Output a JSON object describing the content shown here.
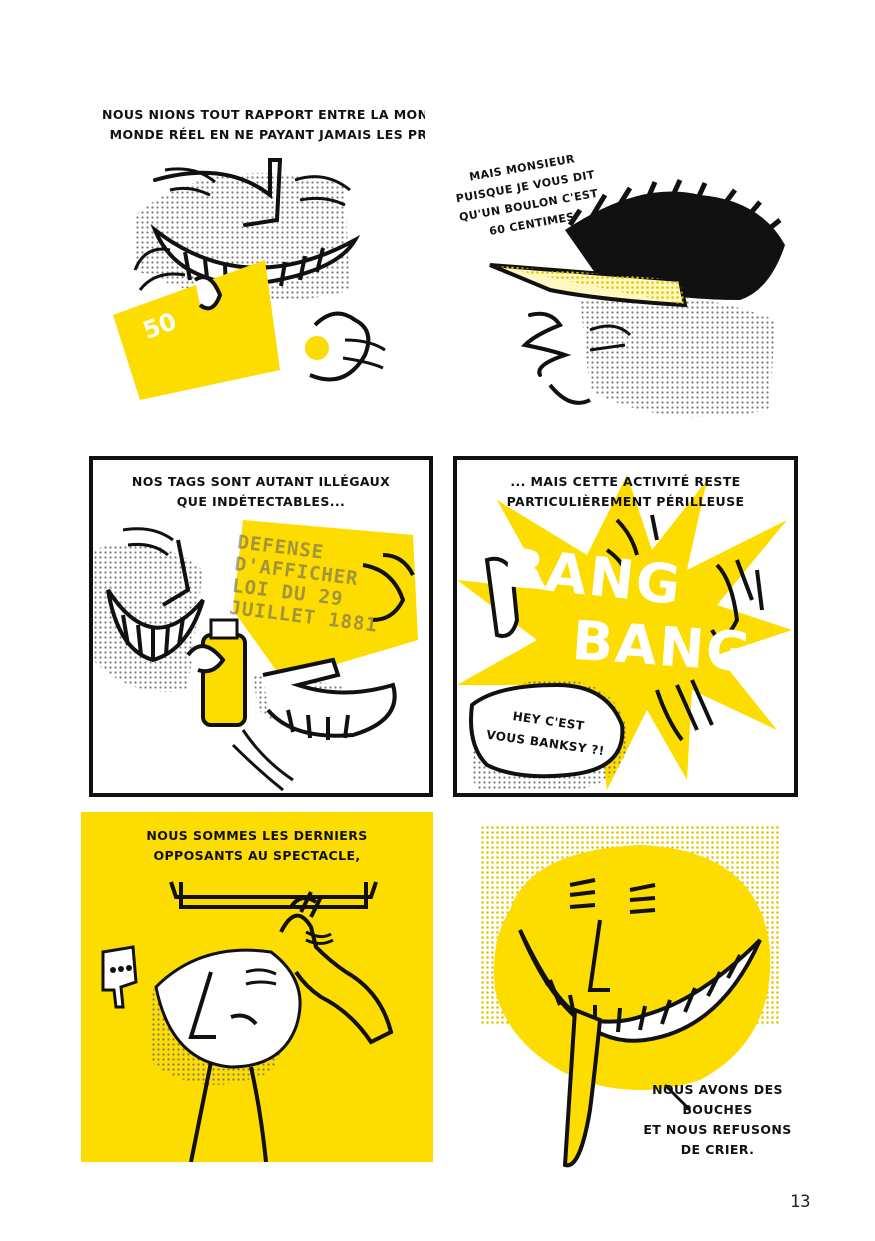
{
  "colors": {
    "yellow": "#fddc00",
    "ink": "#111111",
    "paper": "#ffffff",
    "halftone": "#9a9a9a"
  },
  "page_number": "13",
  "panels": [
    {
      "caption": "NOUS NIONS TOUT RAPPORT ENTRE LA MONNAIE ET LE\nMONDE RÉEL EN NE PAYANT JAMAIS LES PRIX EXIGÉS",
      "banknote": "50"
    },
    {
      "speech": "MAIS MONSIEUR\nPUISQUE JE VOUS DIT\nQU'UN BOULON C'EST\n60 CENTIMES"
    },
    {
      "caption": "NOS TAGS SONT AUTANT ILLÉGAUX\nQUE INDÉTECTABLES...",
      "stencil": "DEFENSE\nD'AFFICHER\nLOI DU 29\nJUILLET 1881"
    },
    {
      "caption": "... MAIS CETTE ACTIVITÉ RESTE\nPARTICULIÈREMENT PÉRILLEUSE",
      "sfx_1": "BANG",
      "sfx_2": "BANG",
      "speech": "HEY C'EST\nVOUS BANKSY ?!"
    },
    {
      "caption": "NOUS SOMMES LES DERNIERS\nOPPOSANTS AU SPECTACLE,"
    },
    {
      "caption": "NOUS AVONS DES\nBOUCHES\nET NOUS REFUSONS\nDE CRIER."
    }
  ]
}
